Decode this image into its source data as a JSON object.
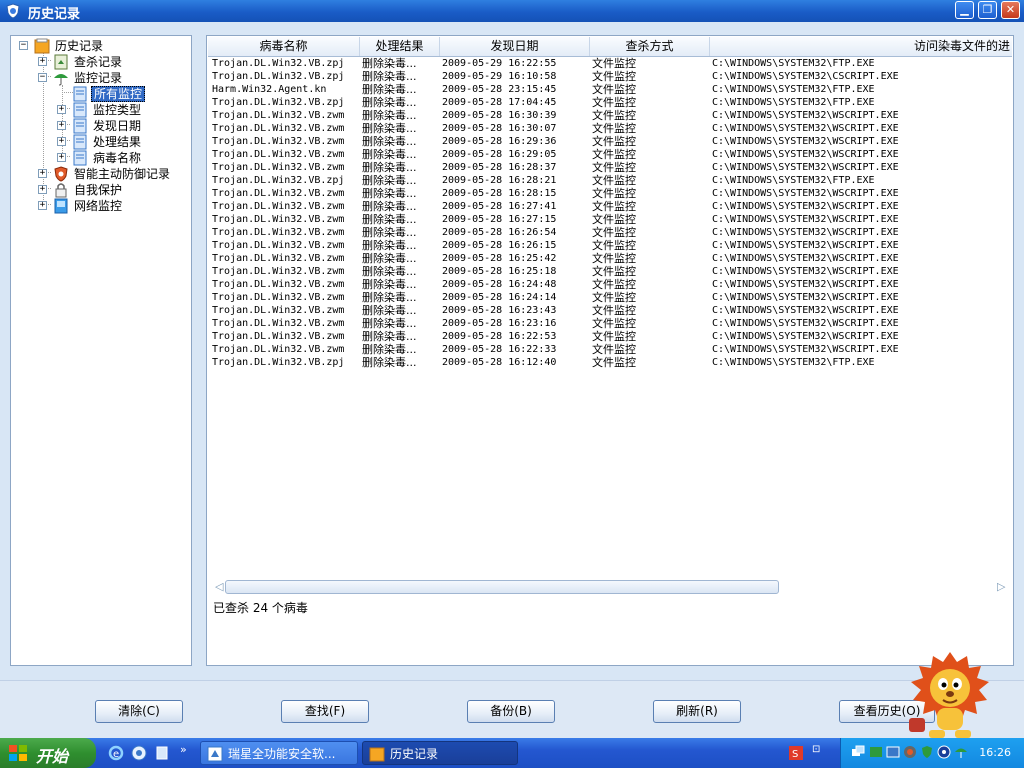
{
  "window": {
    "title": "历史记录"
  },
  "tree": {
    "root": "历史记录",
    "items": [
      {
        "label": "查杀记录"
      },
      {
        "label": "监控记录"
      },
      {
        "label": "所有监控"
      },
      {
        "label": "监控类型"
      },
      {
        "label": "发现日期"
      },
      {
        "label": "处理结果"
      },
      {
        "label": "病毒名称"
      },
      {
        "label": "智能主动防御记录"
      },
      {
        "label": "自我保护"
      },
      {
        "label": "网络监控"
      }
    ]
  },
  "list": {
    "columns": [
      "病毒名称",
      "处理结果",
      "发现日期",
      "查杀方式",
      "访问染毒文件的进"
    ],
    "rows": [
      [
        "Trojan.DL.Win32.VB.zpj",
        "删除染毒...",
        "2009-05-29 16:22:55",
        "文件监控",
        "C:\\WINDOWS\\SYSTEM32\\FTP.EXE"
      ],
      [
        "Trojan.DL.Win32.VB.zpj",
        "删除染毒...",
        "2009-05-29 16:10:58",
        "文件监控",
        "C:\\WINDOWS\\SYSTEM32\\CSCRIPT.EXE"
      ],
      [
        "Harm.Win32.Agent.kn",
        "删除染毒...",
        "2009-05-28 23:15:45",
        "文件监控",
        "C:\\WINDOWS\\SYSTEM32\\FTP.EXE"
      ],
      [
        "Trojan.DL.Win32.VB.zpj",
        "删除染毒...",
        "2009-05-28 17:04:45",
        "文件监控",
        "C:\\WINDOWS\\SYSTEM32\\FTP.EXE"
      ],
      [
        "Trojan.DL.Win32.VB.zwm",
        "删除染毒...",
        "2009-05-28 16:30:39",
        "文件监控",
        "C:\\WINDOWS\\SYSTEM32\\WSCRIPT.EXE"
      ],
      [
        "Trojan.DL.Win32.VB.zwm",
        "删除染毒...",
        "2009-05-28 16:30:07",
        "文件监控",
        "C:\\WINDOWS\\SYSTEM32\\WSCRIPT.EXE"
      ],
      [
        "Trojan.DL.Win32.VB.zwm",
        "删除染毒...",
        "2009-05-28 16:29:36",
        "文件监控",
        "C:\\WINDOWS\\SYSTEM32\\WSCRIPT.EXE"
      ],
      [
        "Trojan.DL.Win32.VB.zwm",
        "删除染毒...",
        "2009-05-28 16:29:05",
        "文件监控",
        "C:\\WINDOWS\\SYSTEM32\\WSCRIPT.EXE"
      ],
      [
        "Trojan.DL.Win32.VB.zwm",
        "删除染毒...",
        "2009-05-28 16:28:37",
        "文件监控",
        "C:\\WINDOWS\\SYSTEM32\\WSCRIPT.EXE"
      ],
      [
        "Trojan.DL.Win32.VB.zpj",
        "删除染毒...",
        "2009-05-28 16:28:21",
        "文件监控",
        "C:\\WINDOWS\\SYSTEM32\\FTP.EXE"
      ],
      [
        "Trojan.DL.Win32.VB.zwm",
        "删除染毒...",
        "2009-05-28 16:28:15",
        "文件监控",
        "C:\\WINDOWS\\SYSTEM32\\WSCRIPT.EXE"
      ],
      [
        "Trojan.DL.Win32.VB.zwm",
        "删除染毒...",
        "2009-05-28 16:27:41",
        "文件监控",
        "C:\\WINDOWS\\SYSTEM32\\WSCRIPT.EXE"
      ],
      [
        "Trojan.DL.Win32.VB.zwm",
        "删除染毒...",
        "2009-05-28 16:27:15",
        "文件监控",
        "C:\\WINDOWS\\SYSTEM32\\WSCRIPT.EXE"
      ],
      [
        "Trojan.DL.Win32.VB.zwm",
        "删除染毒...",
        "2009-05-28 16:26:54",
        "文件监控",
        "C:\\WINDOWS\\SYSTEM32\\WSCRIPT.EXE"
      ],
      [
        "Trojan.DL.Win32.VB.zwm",
        "删除染毒...",
        "2009-05-28 16:26:15",
        "文件监控",
        "C:\\WINDOWS\\SYSTEM32\\WSCRIPT.EXE"
      ],
      [
        "Trojan.DL.Win32.VB.zwm",
        "删除染毒...",
        "2009-05-28 16:25:42",
        "文件监控",
        "C:\\WINDOWS\\SYSTEM32\\WSCRIPT.EXE"
      ],
      [
        "Trojan.DL.Win32.VB.zwm",
        "删除染毒...",
        "2009-05-28 16:25:18",
        "文件监控",
        "C:\\WINDOWS\\SYSTEM32\\WSCRIPT.EXE"
      ],
      [
        "Trojan.DL.Win32.VB.zwm",
        "删除染毒...",
        "2009-05-28 16:24:48",
        "文件监控",
        "C:\\WINDOWS\\SYSTEM32\\WSCRIPT.EXE"
      ],
      [
        "Trojan.DL.Win32.VB.zwm",
        "删除染毒...",
        "2009-05-28 16:24:14",
        "文件监控",
        "C:\\WINDOWS\\SYSTEM32\\WSCRIPT.EXE"
      ],
      [
        "Trojan.DL.Win32.VB.zwm",
        "删除染毒...",
        "2009-05-28 16:23:43",
        "文件监控",
        "C:\\WINDOWS\\SYSTEM32\\WSCRIPT.EXE"
      ],
      [
        "Trojan.DL.Win32.VB.zwm",
        "删除染毒...",
        "2009-05-28 16:23:16",
        "文件监控",
        "C:\\WINDOWS\\SYSTEM32\\WSCRIPT.EXE"
      ],
      [
        "Trojan.DL.Win32.VB.zwm",
        "删除染毒...",
        "2009-05-28 16:22:53",
        "文件监控",
        "C:\\WINDOWS\\SYSTEM32\\WSCRIPT.EXE"
      ],
      [
        "Trojan.DL.Win32.VB.zwm",
        "删除染毒...",
        "2009-05-28 16:22:33",
        "文件监控",
        "C:\\WINDOWS\\SYSTEM32\\WSCRIPT.EXE"
      ],
      [
        "Trojan.DL.Win32.VB.zpj",
        "删除染毒...",
        "2009-05-28 16:12:40",
        "文件监控",
        "C:\\WINDOWS\\SYSTEM32\\FTP.EXE"
      ]
    ],
    "status": "已查杀 24 个病毒"
  },
  "buttons": {
    "clear": "清除(C)",
    "find": "查找(F)",
    "backup": "备份(B)",
    "refresh": "刷新(R)",
    "view_history": "查看历史(O)"
  },
  "taskbar": {
    "start": "开始",
    "items": [
      "瑞星全功能安全软...",
      "历史记录"
    ],
    "clock": "16:26"
  },
  "colors": {
    "titlebar": "#1a5cc7",
    "selection": "#316ac5",
    "taskbar": "#2457d0",
    "start": "#2f8f2f"
  }
}
